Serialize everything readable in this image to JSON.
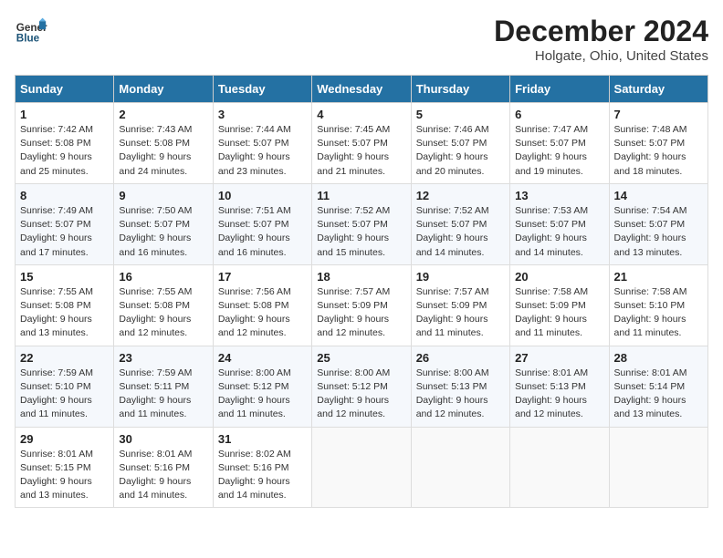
{
  "logo": {
    "general": "General",
    "blue": "Blue"
  },
  "header": {
    "title": "December 2024",
    "subtitle": "Holgate, Ohio, United States"
  },
  "weekdays": [
    "Sunday",
    "Monday",
    "Tuesday",
    "Wednesday",
    "Thursday",
    "Friday",
    "Saturday"
  ],
  "weeks": [
    [
      {
        "day": "1",
        "info": "Sunrise: 7:42 AM\nSunset: 5:08 PM\nDaylight: 9 hours\nand 25 minutes."
      },
      {
        "day": "2",
        "info": "Sunrise: 7:43 AM\nSunset: 5:08 PM\nDaylight: 9 hours\nand 24 minutes."
      },
      {
        "day": "3",
        "info": "Sunrise: 7:44 AM\nSunset: 5:07 PM\nDaylight: 9 hours\nand 23 minutes."
      },
      {
        "day": "4",
        "info": "Sunrise: 7:45 AM\nSunset: 5:07 PM\nDaylight: 9 hours\nand 21 minutes."
      },
      {
        "day": "5",
        "info": "Sunrise: 7:46 AM\nSunset: 5:07 PM\nDaylight: 9 hours\nand 20 minutes."
      },
      {
        "day": "6",
        "info": "Sunrise: 7:47 AM\nSunset: 5:07 PM\nDaylight: 9 hours\nand 19 minutes."
      },
      {
        "day": "7",
        "info": "Sunrise: 7:48 AM\nSunset: 5:07 PM\nDaylight: 9 hours\nand 18 minutes."
      }
    ],
    [
      {
        "day": "8",
        "info": "Sunrise: 7:49 AM\nSunset: 5:07 PM\nDaylight: 9 hours\nand 17 minutes."
      },
      {
        "day": "9",
        "info": "Sunrise: 7:50 AM\nSunset: 5:07 PM\nDaylight: 9 hours\nand 16 minutes."
      },
      {
        "day": "10",
        "info": "Sunrise: 7:51 AM\nSunset: 5:07 PM\nDaylight: 9 hours\nand 16 minutes."
      },
      {
        "day": "11",
        "info": "Sunrise: 7:52 AM\nSunset: 5:07 PM\nDaylight: 9 hours\nand 15 minutes."
      },
      {
        "day": "12",
        "info": "Sunrise: 7:52 AM\nSunset: 5:07 PM\nDaylight: 9 hours\nand 14 minutes."
      },
      {
        "day": "13",
        "info": "Sunrise: 7:53 AM\nSunset: 5:07 PM\nDaylight: 9 hours\nand 14 minutes."
      },
      {
        "day": "14",
        "info": "Sunrise: 7:54 AM\nSunset: 5:07 PM\nDaylight: 9 hours\nand 13 minutes."
      }
    ],
    [
      {
        "day": "15",
        "info": "Sunrise: 7:55 AM\nSunset: 5:08 PM\nDaylight: 9 hours\nand 13 minutes."
      },
      {
        "day": "16",
        "info": "Sunrise: 7:55 AM\nSunset: 5:08 PM\nDaylight: 9 hours\nand 12 minutes."
      },
      {
        "day": "17",
        "info": "Sunrise: 7:56 AM\nSunset: 5:08 PM\nDaylight: 9 hours\nand 12 minutes."
      },
      {
        "day": "18",
        "info": "Sunrise: 7:57 AM\nSunset: 5:09 PM\nDaylight: 9 hours\nand 12 minutes."
      },
      {
        "day": "19",
        "info": "Sunrise: 7:57 AM\nSunset: 5:09 PM\nDaylight: 9 hours\nand 11 minutes."
      },
      {
        "day": "20",
        "info": "Sunrise: 7:58 AM\nSunset: 5:09 PM\nDaylight: 9 hours\nand 11 minutes."
      },
      {
        "day": "21",
        "info": "Sunrise: 7:58 AM\nSunset: 5:10 PM\nDaylight: 9 hours\nand 11 minutes."
      }
    ],
    [
      {
        "day": "22",
        "info": "Sunrise: 7:59 AM\nSunset: 5:10 PM\nDaylight: 9 hours\nand 11 minutes."
      },
      {
        "day": "23",
        "info": "Sunrise: 7:59 AM\nSunset: 5:11 PM\nDaylight: 9 hours\nand 11 minutes."
      },
      {
        "day": "24",
        "info": "Sunrise: 8:00 AM\nSunset: 5:12 PM\nDaylight: 9 hours\nand 11 minutes."
      },
      {
        "day": "25",
        "info": "Sunrise: 8:00 AM\nSunset: 5:12 PM\nDaylight: 9 hours\nand 12 minutes."
      },
      {
        "day": "26",
        "info": "Sunrise: 8:00 AM\nSunset: 5:13 PM\nDaylight: 9 hours\nand 12 minutes."
      },
      {
        "day": "27",
        "info": "Sunrise: 8:01 AM\nSunset: 5:13 PM\nDaylight: 9 hours\nand 12 minutes."
      },
      {
        "day": "28",
        "info": "Sunrise: 8:01 AM\nSunset: 5:14 PM\nDaylight: 9 hours\nand 13 minutes."
      }
    ],
    [
      {
        "day": "29",
        "info": "Sunrise: 8:01 AM\nSunset: 5:15 PM\nDaylight: 9 hours\nand 13 minutes."
      },
      {
        "day": "30",
        "info": "Sunrise: 8:01 AM\nSunset: 5:16 PM\nDaylight: 9 hours\nand 14 minutes."
      },
      {
        "day": "31",
        "info": "Sunrise: 8:02 AM\nSunset: 5:16 PM\nDaylight: 9 hours\nand 14 minutes."
      },
      null,
      null,
      null,
      null
    ]
  ]
}
